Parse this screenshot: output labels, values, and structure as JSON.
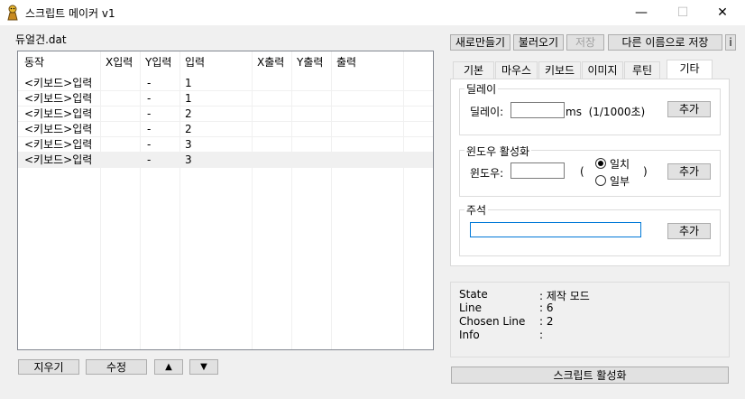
{
  "window": {
    "title": "스크립트 메이커 v1",
    "minimize": "—",
    "maximize": "☐",
    "close": "✕"
  },
  "file_label": "듀얼건.dat",
  "list": {
    "columns": [
      "동작",
      "X입력",
      "Y입력",
      "입력",
      "X출력",
      "Y출력",
      "출력"
    ],
    "rows": [
      [
        "<키보드>입력",
        "",
        "-",
        "1",
        "",
        "",
        ""
      ],
      [
        "<키보드>입력",
        "",
        "-",
        "1",
        "",
        "",
        ""
      ],
      [
        "<키보드>입력",
        "",
        "-",
        "2",
        "",
        "",
        ""
      ],
      [
        "<키보드>입력",
        "",
        "-",
        "2",
        "",
        "",
        ""
      ],
      [
        "<키보드>입력",
        "",
        "-",
        "3",
        "",
        "",
        ""
      ],
      [
        "<키보드>입력",
        "",
        "-",
        "3",
        "",
        "",
        ""
      ]
    ]
  },
  "bottom_buttons": {
    "delete": "지우기",
    "edit": "수정",
    "up": "▲",
    "down": "▼"
  },
  "toolbar": {
    "new": "새로만들기",
    "load": "불러오기",
    "save": "저장",
    "save_as": "다른 이름으로 저장",
    "info": "i"
  },
  "tabs": [
    "기본",
    "마우스",
    "키보드",
    "이미지",
    "루틴",
    "기타"
  ],
  "delay_group": {
    "title": "딜레이",
    "label": "딜레이:",
    "value": "",
    "unit": "ms  (1/1000초)",
    "add": "추가"
  },
  "window_group": {
    "title": "윈도우 활성화",
    "label": "윈도우:",
    "value": "",
    "paren_open": "(",
    "paren_close": ")",
    "radio_exact": "일치",
    "radio_partial": "일부",
    "add": "추가"
  },
  "comment_group": {
    "title": "주석",
    "value": "",
    "add": "추가"
  },
  "status": {
    "state_label": "State",
    "state_value": ": 제작 모드",
    "line_label": "Line",
    "line_value": ": 6",
    "chosen_label": "Chosen Line",
    "chosen_value": ": 2",
    "info_label": "Info",
    "info_value": ":"
  },
  "activate_button": "스크립트 활성화"
}
